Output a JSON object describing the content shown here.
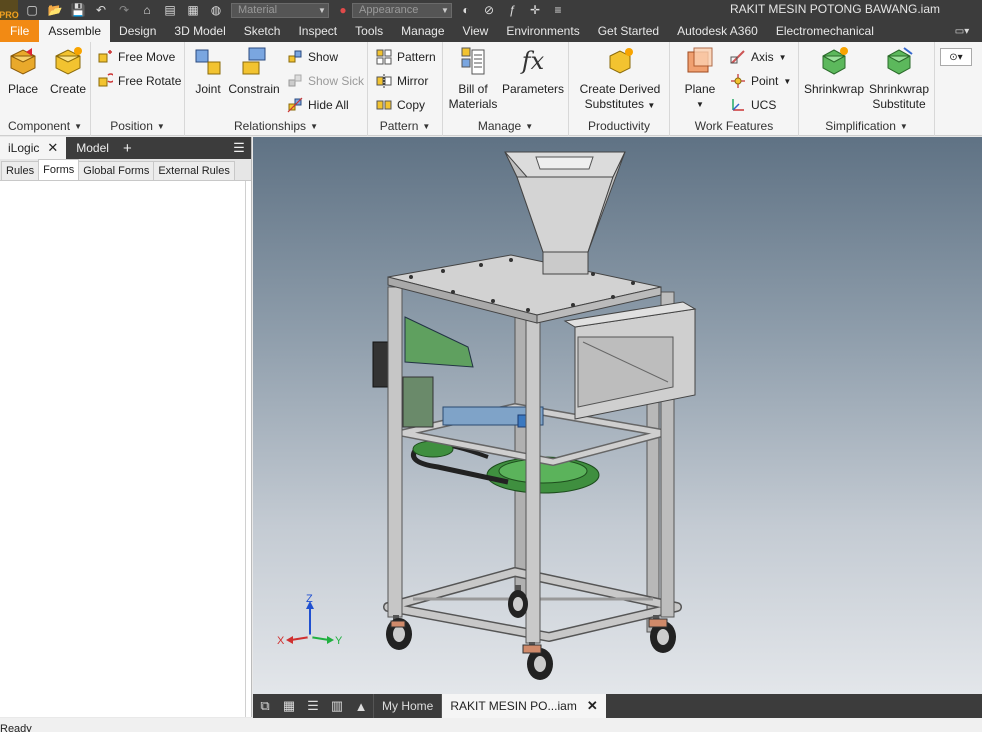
{
  "app": {
    "window_title": "RAKIT MESIN POTONG BAWANG.iam",
    "logo_text": "PRO"
  },
  "quick_access": {
    "material_placeholder": "Material",
    "appearance_placeholder": "Appearance"
  },
  "tabs": [
    {
      "label": "File"
    },
    {
      "label": "Assemble"
    },
    {
      "label": "Design"
    },
    {
      "label": "3D Model"
    },
    {
      "label": "Sketch"
    },
    {
      "label": "Inspect"
    },
    {
      "label": "Tools"
    },
    {
      "label": "Manage"
    },
    {
      "label": "View"
    },
    {
      "label": "Environments"
    },
    {
      "label": "Get Started"
    },
    {
      "label": "Autodesk A360"
    },
    {
      "label": "Electromechanical"
    }
  ],
  "ribbon": {
    "component": {
      "title": "Component",
      "place": "Place",
      "create": "Create"
    },
    "position": {
      "title": "Position",
      "free_move": "Free Move",
      "free_rotate": "Free Rotate"
    },
    "relationships": {
      "title": "Relationships",
      "joint": "Joint",
      "constrain": "Constrain",
      "show": "Show",
      "show_sick": "Show Sick",
      "hide_all": "Hide All"
    },
    "pattern": {
      "title": "Pattern",
      "pattern": "Pattern",
      "mirror": "Mirror",
      "copy": "Copy"
    },
    "manage": {
      "title": "Manage",
      "bom_line1": "Bill of",
      "bom_line2": "Materials",
      "parameters": "Parameters",
      "fx_glyph": "fx"
    },
    "productivity": {
      "title": "Productivity",
      "cds_line1": "Create Derived",
      "cds_line2": "Substitutes"
    },
    "work_features": {
      "title": "Work Features",
      "plane": "Plane",
      "axis": "Axis",
      "point": "Point",
      "ucs": "UCS"
    },
    "simplification": {
      "title": "Simplification",
      "shrinkwrap": "Shrinkwrap",
      "shrinkwrap_sub_line1": "Shrinkwrap",
      "shrinkwrap_sub_line2": "Substitute"
    }
  },
  "browser": {
    "tabs": [
      {
        "label": "iLogic"
      },
      {
        "label": "Model"
      }
    ],
    "subtabs": [
      {
        "label": "Rules"
      },
      {
        "label": "Forms"
      },
      {
        "label": "Global Forms"
      },
      {
        "label": "External Rules"
      }
    ]
  },
  "viewport": {
    "axis_x": "X",
    "axis_y": "Y",
    "axis_z": "Z"
  },
  "doc_tabs": [
    {
      "label": "My Home"
    },
    {
      "label": "RAKIT MESIN PO...iam"
    }
  ],
  "status": {
    "text": "Ready"
  },
  "colors": {
    "accent_file": "#f28a14",
    "dark_bar": "#3c3c3c",
    "ribbon_bg": "#f5f5f5"
  }
}
